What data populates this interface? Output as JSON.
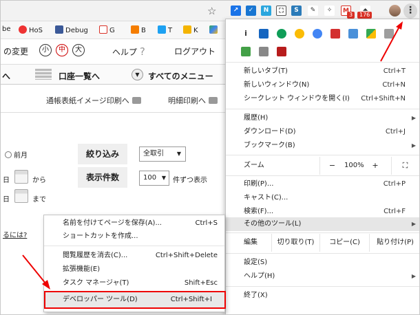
{
  "toolbar": {
    "extension_badges": [
      "3",
      "176"
    ]
  },
  "bookmarks": {
    "items": [
      {
        "label": "be"
      },
      {
        "label": "HoS"
      },
      {
        "label": "Debug"
      },
      {
        "label": "G"
      },
      {
        "label": "B"
      },
      {
        "label": "T"
      },
      {
        "label": "K"
      }
    ]
  },
  "page": {
    "nav_top": {
      "change_label": "の変更",
      "font_small": "小",
      "font_medium": "中",
      "font_large": "大",
      "help": "ヘルプ",
      "help_mark": "?",
      "logout": "ログアウト"
    },
    "nav_main": {
      "arrow_left": "へ",
      "account_list": "口座一覧へ",
      "all_menu": "すべてのメニュー"
    },
    "nav_sub": {
      "passbook_print": "通帳表紙イメージ印刷へ",
      "statement_print": "明細印刷へ"
    },
    "filter": {
      "prev_month": "前月",
      "narrow_label": "絞り込み",
      "narrow_value": "全取引",
      "count_label": "表示件数",
      "count_value": "100",
      "count_suffix": "件ずつ表示",
      "from_prefix": "日",
      "from": "から",
      "to_prefix": "日",
      "to": "まで",
      "link_text": "るには?"
    }
  },
  "chrome_menu": {
    "items": [
      {
        "label": "新しいタブ(T)",
        "shortcut": "Ctrl+T"
      },
      {
        "label": "新しいウィンドウ(N)",
        "shortcut": "Ctrl+N"
      },
      {
        "label": "シークレット ウィンドウを開く(I)",
        "shortcut": "Ctrl+Shift+N"
      },
      {
        "label": "履歴(H)",
        "shortcut": ""
      },
      {
        "label": "ダウンロード(D)",
        "shortcut": "Ctrl+J"
      },
      {
        "label": "ブックマーク(B)",
        "shortcut": ""
      },
      {
        "label": "印刷(P)...",
        "shortcut": "Ctrl+P"
      },
      {
        "label": "キャスト(C)...",
        "shortcut": ""
      },
      {
        "label": "検索(F)...",
        "shortcut": "Ctrl+F"
      },
      {
        "label": "その他のツール(L)",
        "shortcut": ""
      },
      {
        "label": "設定(S)",
        "shortcut": ""
      },
      {
        "label": "ヘルプ(H)",
        "shortcut": ""
      },
      {
        "label": "終了(X)",
        "shortcut": ""
      }
    ],
    "zoom": {
      "label": "ズーム",
      "minus": "−",
      "value": "100%",
      "plus": "+",
      "fullscreen": "⛶"
    },
    "edit": {
      "label": "編集",
      "cut": "切り取り(T)",
      "copy": "コピー(C)",
      "paste": "貼り付け(P)"
    }
  },
  "submenu": {
    "items": [
      {
        "label": "名前を付けてページを保存(A)...",
        "shortcut": "Ctrl+S"
      },
      {
        "label": "ショートカットを作成...",
        "shortcut": ""
      },
      {
        "label": "閲覧履歴を消去(C)...",
        "shortcut": "Ctrl+Shift+Delete"
      },
      {
        "label": "拡張機能(E)",
        "shortcut": ""
      },
      {
        "label": "タスク マネージャ(T)",
        "shortcut": "Shift+Esc"
      },
      {
        "label": "デベロッパー ツール(D)",
        "shortcut": "Ctrl+Shift+I"
      }
    ]
  },
  "colors": {
    "highlight_border": "#e00000",
    "arrow": "#e00000"
  }
}
